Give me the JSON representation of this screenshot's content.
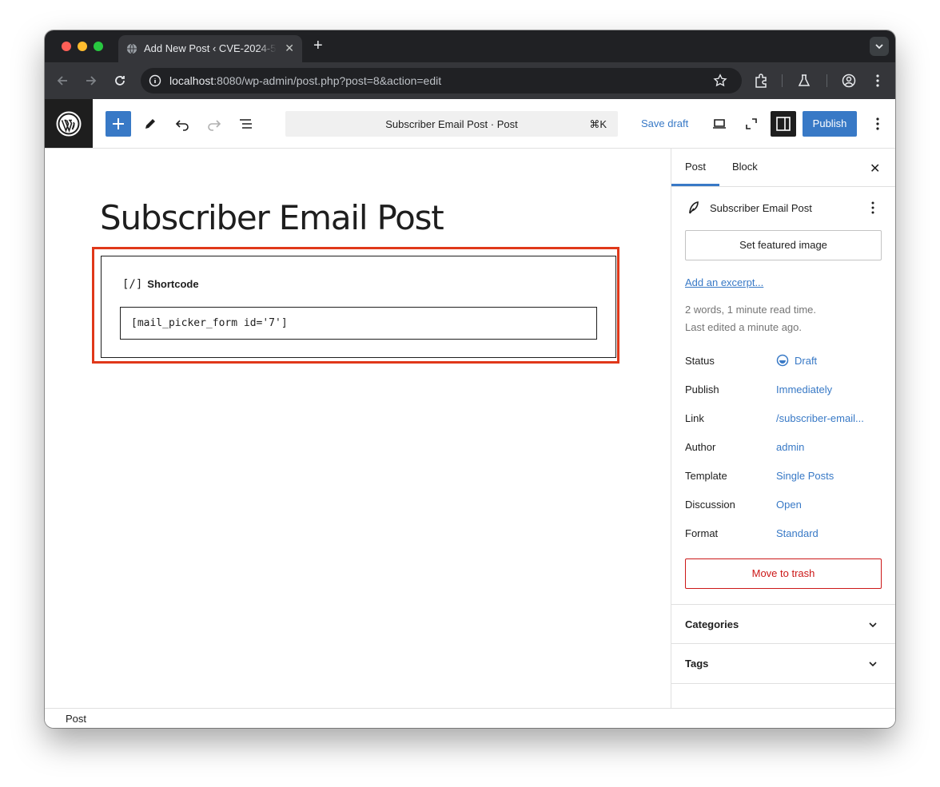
{
  "browser": {
    "tab_title": "Add New Post ‹ CVE-2024-5",
    "url_host": "localhost",
    "url_rest": ":8080/wp-admin/post.php?post=8&action=edit"
  },
  "header": {
    "command_title": "Subscriber Email Post · Post",
    "command_shortcut": "⌘K",
    "save_draft": "Save draft",
    "publish": "Publish"
  },
  "editor": {
    "title": "Subscriber Email Post",
    "block_icon": "[/]",
    "block_label": "Shortcode",
    "shortcode_value": "[mail_picker_form id='7']"
  },
  "sidebar": {
    "tab_post": "Post",
    "tab_block": "Block",
    "post_title": "Subscriber Email Post",
    "featured_image": "Set featured image",
    "excerpt_link": "Add an excerpt...",
    "stats_line1": "2 words, 1 minute read time.",
    "stats_line2": "Last edited a minute ago.",
    "rows": [
      {
        "label": "Status",
        "value": "Draft"
      },
      {
        "label": "Publish",
        "value": "Immediately"
      },
      {
        "label": "Link",
        "value": "/subscriber-email..."
      },
      {
        "label": "Author",
        "value": "admin"
      },
      {
        "label": "Template",
        "value": "Single Posts"
      },
      {
        "label": "Discussion",
        "value": "Open"
      },
      {
        "label": "Format",
        "value": "Standard"
      }
    ],
    "trash": "Move to trash",
    "panels": [
      {
        "label": "Categories"
      },
      {
        "label": "Tags"
      }
    ]
  },
  "footer": {
    "breadcrumb": "Post"
  },
  "colors": {
    "accent": "#3879c6",
    "highlight": "#e0381a",
    "danger": "#cc1818"
  }
}
